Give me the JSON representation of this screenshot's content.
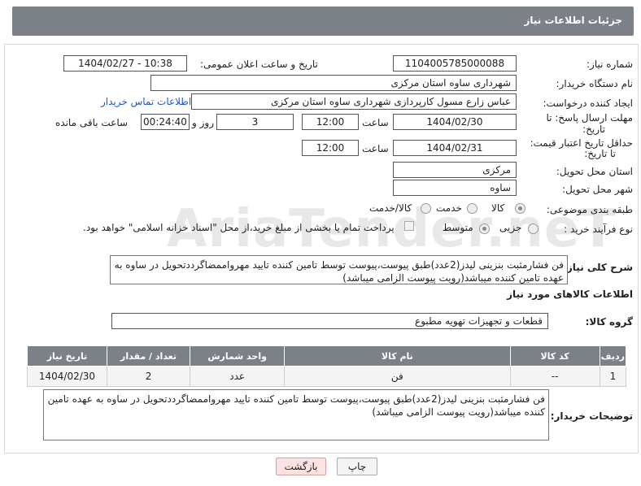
{
  "header": {
    "title": "جزئیات اطلاعات نیاز"
  },
  "fields": {
    "need_number_label": "شماره نیاز:",
    "need_number": "1104005785000088",
    "announce_label": "تاریخ و ساعت اعلان عمومی:",
    "announce_value": "1404/02/27 - 10:38",
    "buyer_org_label": "نام دستگاه خریدار:",
    "buyer_org": "شهرداری ساوه استان مرکزی",
    "requester_label": "ایجاد کننده درخواست:",
    "requester": "عباس زارع مسول کارپردازی شهرداری ساوه استان مرکزی",
    "contact_link": "اطلاعات تماس خریدار",
    "deadline_label_1": "مهلت ارسال پاسخ: تا",
    "deadline_label_2": "تاریخ:",
    "deadline_date": "1404/02/30",
    "time_label": "ساعت",
    "deadline_time": "12:00",
    "days_value": "3",
    "days_label": "روز و",
    "remaining_value": "00:24:40",
    "remaining_label": "ساعت باقی مانده",
    "validity_label_1": "حداقل تاریخ اعتبار قیمت:",
    "validity_label_2": "تا تاریخ:",
    "validity_date": "1404/02/31",
    "validity_time": "12:00",
    "province_label": "استان محل تحویل:",
    "province": "مرکزی",
    "city_label": "شهر محل تحویل:",
    "city": "ساوه",
    "category_label": "طبقه بندی موضوعی:",
    "category_options": [
      "کالا",
      "خدمت",
      "کالا/خدمت"
    ],
    "process_label": "نوع فرآیند خرید :",
    "process_options": [
      "جزیی",
      "متوسط"
    ],
    "payment_note": "پرداخت تمام یا بخشی از مبلغ خرید،از محل \"اسناد خزانه اسلامی\" خواهد بود.",
    "summary_label": "شرح کلی نیاز:",
    "summary": "فن فشارمثبت بنزینی لیدز(2عدد)طبق پیوست،پیوست توسط تامین کننده تایید مهرواممضاگرددتحویل در ساوه به عهده تامین کننده میباشد(رویت پیوست الزامی میباشد)",
    "goods_info_label": "اطلاعات کالاهای مورد نیاز",
    "goods_group_label": "گروه کالا:",
    "goods_group": "قطعات و تجهیزات تهویه مطبوع",
    "buyer_notes_label": "توضیحات خریدار:",
    "buyer_notes": "فن فشارمثبت بنزینی لیدز(2عدد)طبق پیوست،پیوست توسط تامین کننده تایید مهرواممضاگرددتحویل در ساوه به عهده تامین کننده میباشد(رویت پیوست الزامی میباشد)"
  },
  "table": {
    "headers": [
      "ردیف",
      "کد کالا",
      "نام کالا",
      "واحد شمارش",
      "تعداد / مقدار",
      "تاریخ نیاز"
    ],
    "rows": [
      [
        "1",
        "--",
        "فن",
        "عدد",
        "2",
        "1404/02/30"
      ]
    ]
  },
  "buttons": {
    "print": "چاپ",
    "back": "بازگشت"
  },
  "watermark": "AriaTender.neT"
}
